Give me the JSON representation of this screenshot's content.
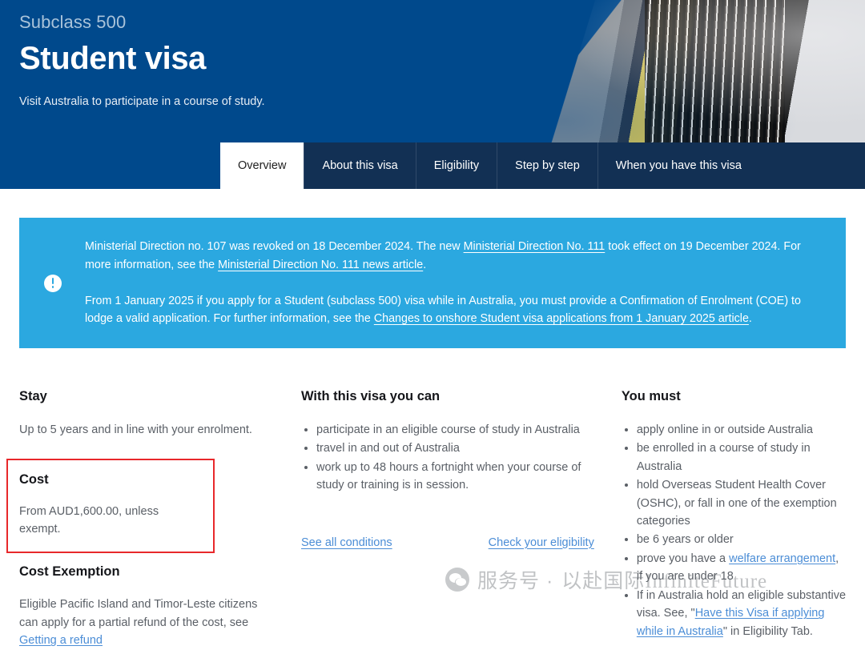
{
  "hero": {
    "subclass": "Subclass 500",
    "title": "Student visa",
    "tagline": "Visit Australia to participate in a course of study.",
    "brand_color": "#00498c",
    "photo_alt": "student-photo"
  },
  "tabs": [
    {
      "label": "Overview",
      "active": true
    },
    {
      "label": "About this visa",
      "active": false
    },
    {
      "label": "Eligibility",
      "active": false
    },
    {
      "label": "Step by step",
      "active": false
    },
    {
      "label": "When you have this visa",
      "active": false
    }
  ],
  "tabbar_color": "#123054",
  "alert": {
    "icon": "exclamation-circle-icon",
    "background_color": "#2ba8e0",
    "paragraph1": {
      "part1": "Ministerial Direction no. 107 was revoked on 18 December 2024. The new ",
      "link1": "Ministerial Direction No. 111",
      "part2": " took effect on 19 December 2024. For more information, see the ",
      "link2": "Ministerial Direction No. 111 news article",
      "part3": "."
    },
    "paragraph2": {
      "part1": "From 1 January 2025 if you apply for a Student (subclass 500) visa while in Australia, you must provide a Confirmation of Enrolment (COE) to lodge a valid application. For further information, see the ",
      "link1": "Changes to onshore Student visa applications from 1 January 2025 article",
      "part2": "."
    }
  },
  "columns": {
    "left": {
      "stay": {
        "heading": "Stay",
        "text": "Up to 5 years and in line with your enrolment."
      },
      "cost": {
        "heading": "Cost",
        "text": "From AUD1,600.00, unless exempt.",
        "highlight_color": "#e8282b"
      },
      "cost_exemption": {
        "heading": "Cost Exemption",
        "text_part1": "Eligible Pacific Island and Timor-Leste citizens can apply for a partial refund of the cost, see ",
        "link": "Getting a refund"
      }
    },
    "middle": {
      "heading": "With this visa you can",
      "bullets": [
        "participate in an eligible course of study in Australia",
        "travel in and out of Australia",
        "work up to 48 hours a fortnight when your course of study or training is in session."
      ],
      "link_conditions": "See all conditions",
      "link_eligibility": "Check your eligibility"
    },
    "right": {
      "heading": "You must",
      "bullets": [
        {
          "text": "apply online in or outside Australia"
        },
        {
          "text": "be enrolled in a course of study in Australia"
        },
        {
          "text": "hold Overseas Student Health Cover (OSHC), or fall in one of the exemption categories"
        },
        {
          "text": "be 6 years or older"
        },
        {
          "part1": "prove you have a ",
          "link": "welfare arrangement",
          "part2": ", if you are under 18"
        },
        {
          "part1": "If in Australia hold an eligible substantive visa. See, \"",
          "link": "Have this Visa if applying while in Australia",
          "part2": "\" in Eligibility Tab."
        }
      ]
    }
  },
  "watermark": {
    "logo": "wechat-logo-icon",
    "text_cn": "服务号 ·",
    "text_mixed": "以赴国际InfiniteFuture"
  }
}
